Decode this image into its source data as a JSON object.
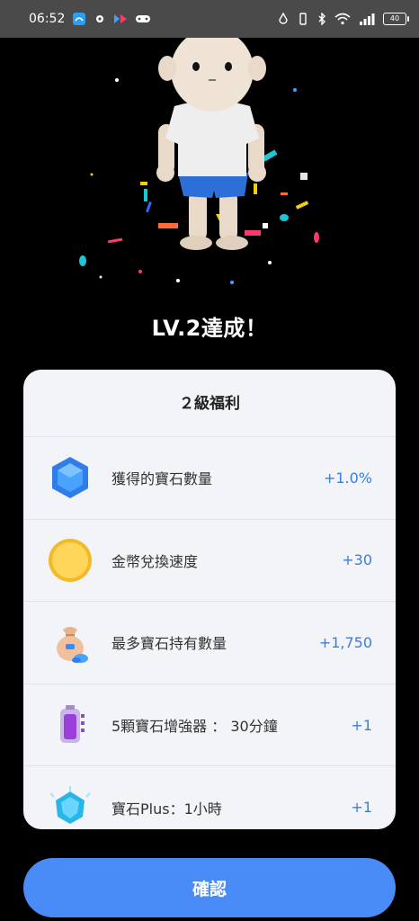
{
  "status_bar": {
    "time": "06:52",
    "battery": "40",
    "icons": [
      "chat-app-icon",
      "gear-icon",
      "media-icon",
      "gamepad-icon",
      "alarm-icon",
      "vibrate-icon",
      "bluetooth-icon",
      "wifi-icon",
      "signal-icon",
      "battery-icon"
    ]
  },
  "level_title": "LV.2達成！",
  "card": {
    "title": "２級福利",
    "items": [
      {
        "icon": "blue-gem-icon",
        "label": "獲得的寶石數量",
        "value": "+1.0%"
      },
      {
        "icon": "gold-coin-icon",
        "label": "金幣兌換速度",
        "value": "+30"
      },
      {
        "icon": "money-bag-icon",
        "label": "最多寶石持有數量",
        "value": "+1,750"
      },
      {
        "icon": "battery-booster-icon",
        "label": "5顆寶石增強器 ： 30分鐘",
        "value": "+1"
      },
      {
        "icon": "gem-plus-icon",
        "label": "寶石Plus：1小時",
        "value": "+1"
      }
    ]
  },
  "confirm_label": "確認",
  "colors": {
    "accent": "#4a8cf7",
    "value_text": "#3a7de0",
    "card_bg": "#f3f4f7"
  }
}
